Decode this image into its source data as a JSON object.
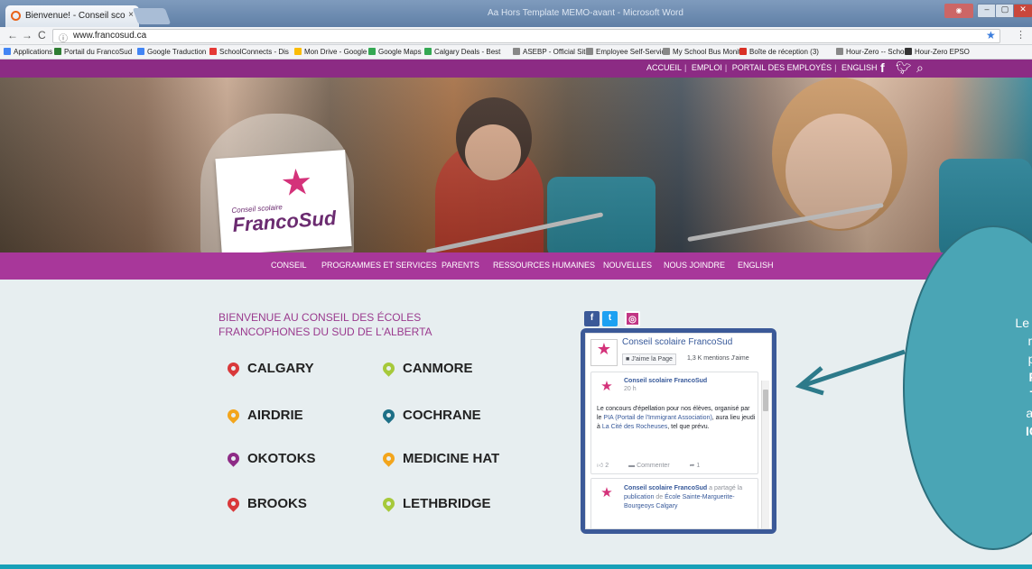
{
  "browser": {
    "tab_title": "Bienvenue! - Conseil sco",
    "tab_close": "×",
    "window_title": "Aa Hors Template MEMO-avant - Microsoft Word",
    "window_controls": [
      "–",
      "▢",
      "✕"
    ],
    "url": "www.francosud.ca",
    "bookmarks": [
      {
        "label": "Applications",
        "color": "#4285f4"
      },
      {
        "label": "Portail du FrancoSud",
        "color": "#2e7d32"
      },
      {
        "label": "Google Traduction",
        "color": "#4285f4"
      },
      {
        "label": "SchoolConnects - Dis",
        "color": "#e53935"
      },
      {
        "label": "Mon Drive - Google I",
        "color": "#fbbc05"
      },
      {
        "label": "Google Maps",
        "color": "#34a853"
      },
      {
        "label": "Calgary Deals - Best",
        "color": "#34a853"
      },
      {
        "label": "ASEBP - Official Site",
        "color": "#888888"
      },
      {
        "label": "Employee Self-Service",
        "color": "#888888"
      },
      {
        "label": "My School Bus Monit",
        "color": "#888888"
      },
      {
        "label": "Boîte de réception (3)",
        "color": "#d93025"
      },
      {
        "label": "Hour-Zero -- School",
        "color": "#888888"
      },
      {
        "label": "Hour-Zero EPSO",
        "color": "#333333"
      }
    ]
  },
  "topnav": {
    "links": [
      "ACCUEIL",
      "EMPLOI",
      "PORTAIL DES EMPLOYÉS",
      "ENGLISH"
    ]
  },
  "logo": {
    "subtitle": "Conseil scolaire",
    "name": "FrancoSud"
  },
  "mainnav": {
    "items": [
      "CONSEIL",
      "PROGRAMMES ET SERVICES",
      "PARENTS",
      "RESSOURCES HUMAINES",
      "NOUVELLES",
      "NOUS JOINDRE",
      "ENGLISH"
    ]
  },
  "welcome": {
    "line1": "BIENVENUE AU CONSEIL DES ÉCOLES",
    "line2": "FRANCOPHONES DU SUD DE L'ALBERTA"
  },
  "locations": [
    {
      "name": "CALGARY",
      "color": "#d9383a"
    },
    {
      "name": "CANMORE",
      "color": "#a6c93a"
    },
    {
      "name": "AIRDRIE",
      "color": "#f3a51c"
    },
    {
      "name": "COCHRANE",
      "color": "#1d6f86"
    },
    {
      "name": "OKOTOKS",
      "color": "#8e2b86"
    },
    {
      "name": "MEDICINE HAT",
      "color": "#f3a51c"
    },
    {
      "name": "BROOKS",
      "color": "#d9383a"
    },
    {
      "name": "LETHBRIDGE",
      "color": "#a6c93a"
    }
  ],
  "facebook_widget": {
    "page_name": "Conseil scolaire FrancoSud",
    "like_button": "J'aime la Page",
    "likes_count": "1,3 K mentions J'aime",
    "post1": {
      "author": "Conseil scolaire FrancoSud",
      "time": "20 h",
      "text_a": "Le concours d'épellation pour nos élèves, organisé par le ",
      "link1": "PIA (Portail de l'Immigrant Association)",
      "text_b": ", aura lieu jeudi à ",
      "link2": "La Cité des Rocheuses",
      "text_c": ", tel que prévu.",
      "likes": "2",
      "comment": "Commenter",
      "shares": "1"
    },
    "post2": {
      "author": "Conseil scolaire FrancoSud",
      "text_a": " a partagé la ",
      "link1": "publication",
      "text_b": " de ",
      "link2": "École Sainte-Marguerite-Bourgeoys Calgary"
    }
  },
  "callout": {
    "l1": "Le",
    "l2": "mess",
    "l3": "publie",
    "l4": "Faceb",
    "l5": "Twitte",
    "l6": "access",
    "l7": "IC"
  }
}
